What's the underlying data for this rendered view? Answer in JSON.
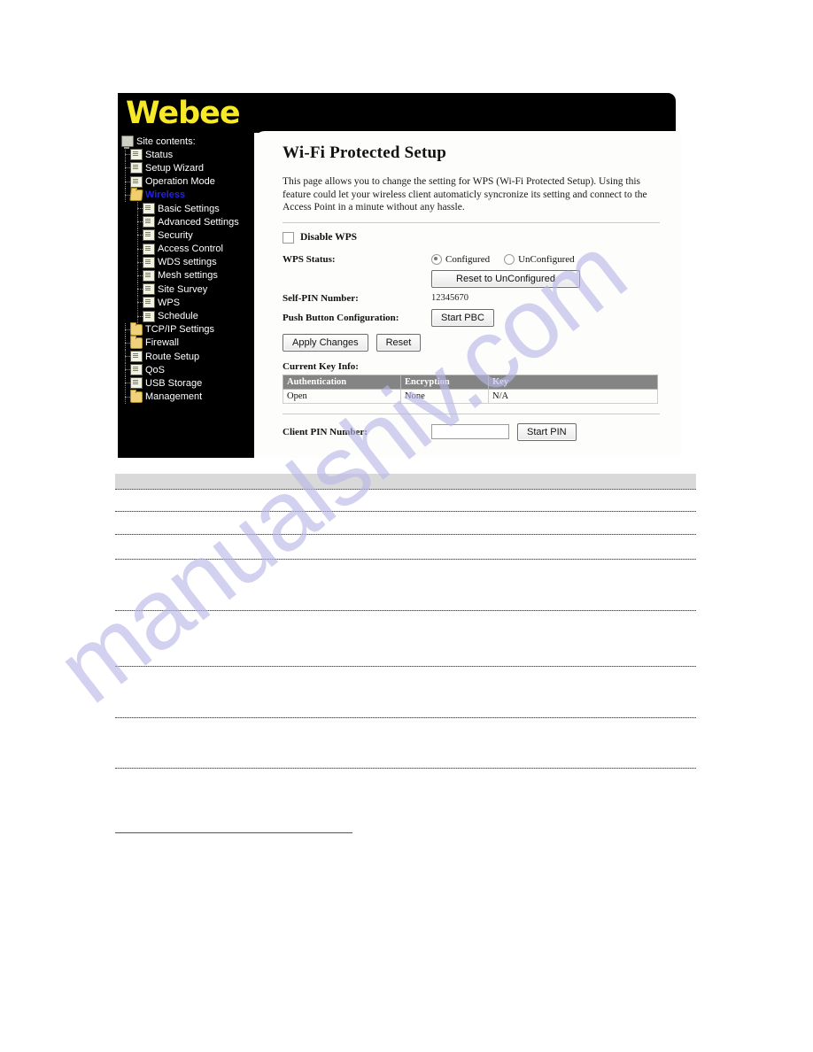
{
  "brand": {
    "logo_text": "Webee",
    "logo_color": "#f7e928",
    "header_bg": "#000000"
  },
  "watermark": {
    "text": "manualshiv.com",
    "color": "#b9b6e8"
  },
  "sidebar": {
    "root_label": "Site contents:",
    "root_icon": "monitor-icon",
    "items": [
      {
        "label": "Status",
        "icon": "page-icon",
        "level": 1,
        "active": false
      },
      {
        "label": "Setup Wizard",
        "icon": "page-icon",
        "level": 1,
        "active": false
      },
      {
        "label": "Operation Mode",
        "icon": "page-icon",
        "level": 1,
        "active": false
      },
      {
        "label": "Wireless",
        "icon": "folder-open-icon",
        "level": 1,
        "active": true
      },
      {
        "label": "Basic Settings",
        "icon": "page-icon",
        "level": 2,
        "active": false
      },
      {
        "label": "Advanced Settings",
        "icon": "page-icon",
        "level": 2,
        "active": false
      },
      {
        "label": "Security",
        "icon": "page-icon",
        "level": 2,
        "active": false
      },
      {
        "label": "Access Control",
        "icon": "page-icon",
        "level": 2,
        "active": false
      },
      {
        "label": "WDS settings",
        "icon": "page-icon",
        "level": 2,
        "active": false
      },
      {
        "label": "Mesh settings",
        "icon": "page-icon",
        "level": 2,
        "active": false
      },
      {
        "label": "Site Survey",
        "icon": "page-icon",
        "level": 2,
        "active": false
      },
      {
        "label": "WPS",
        "icon": "page-icon",
        "level": 2,
        "active": false
      },
      {
        "label": "Schedule",
        "icon": "page-icon",
        "level": 2,
        "active": false
      },
      {
        "label": "TCP/IP Settings",
        "icon": "folder-icon",
        "level": 1,
        "active": false
      },
      {
        "label": "Firewall",
        "icon": "folder-icon",
        "level": 1,
        "active": false
      },
      {
        "label": "Route Setup",
        "icon": "page-icon",
        "level": 1,
        "active": false
      },
      {
        "label": "QoS",
        "icon": "page-icon",
        "level": 1,
        "active": false
      },
      {
        "label": "USB Storage",
        "icon": "page-icon",
        "level": 1,
        "active": false
      },
      {
        "label": "Management",
        "icon": "folder-icon",
        "level": 1,
        "active": false
      }
    ]
  },
  "main": {
    "title": "Wi-Fi Protected Setup",
    "intro": "This page allows you to change the setting for WPS (Wi-Fi Protected Setup). Using this feature could let your wireless client automaticly syncronize its setting and connect to the Access Point in a minute without any hassle.",
    "disable_wps_label": "Disable WPS",
    "disable_wps_checked": false,
    "wps_status_label": "WPS Status:",
    "radio_configured_label": "Configured",
    "radio_unconfigured_label": "UnConfigured",
    "radio_selected": "Configured",
    "reset_unconfigured_label": "Reset to UnConfigured",
    "self_pin_label": "Self-PIN Number:",
    "self_pin_value": "12345670",
    "pbc_label": "Push Button Configuration:",
    "pbc_button_label": "Start PBC",
    "apply_label": "Apply Changes",
    "reset_label": "Reset",
    "key_info_label": "Current Key Info:",
    "key_table": {
      "headers": [
        "Authentication",
        "Encryption",
        "Key"
      ],
      "rows": [
        [
          "Open",
          "None",
          "N/A"
        ]
      ]
    },
    "client_pin_label": "Client PIN Number:",
    "client_pin_value": "",
    "start_pin_label": "Start PIN"
  },
  "lower_table": {
    "header_bg": "#d9d9d9",
    "row_count": 8
  }
}
